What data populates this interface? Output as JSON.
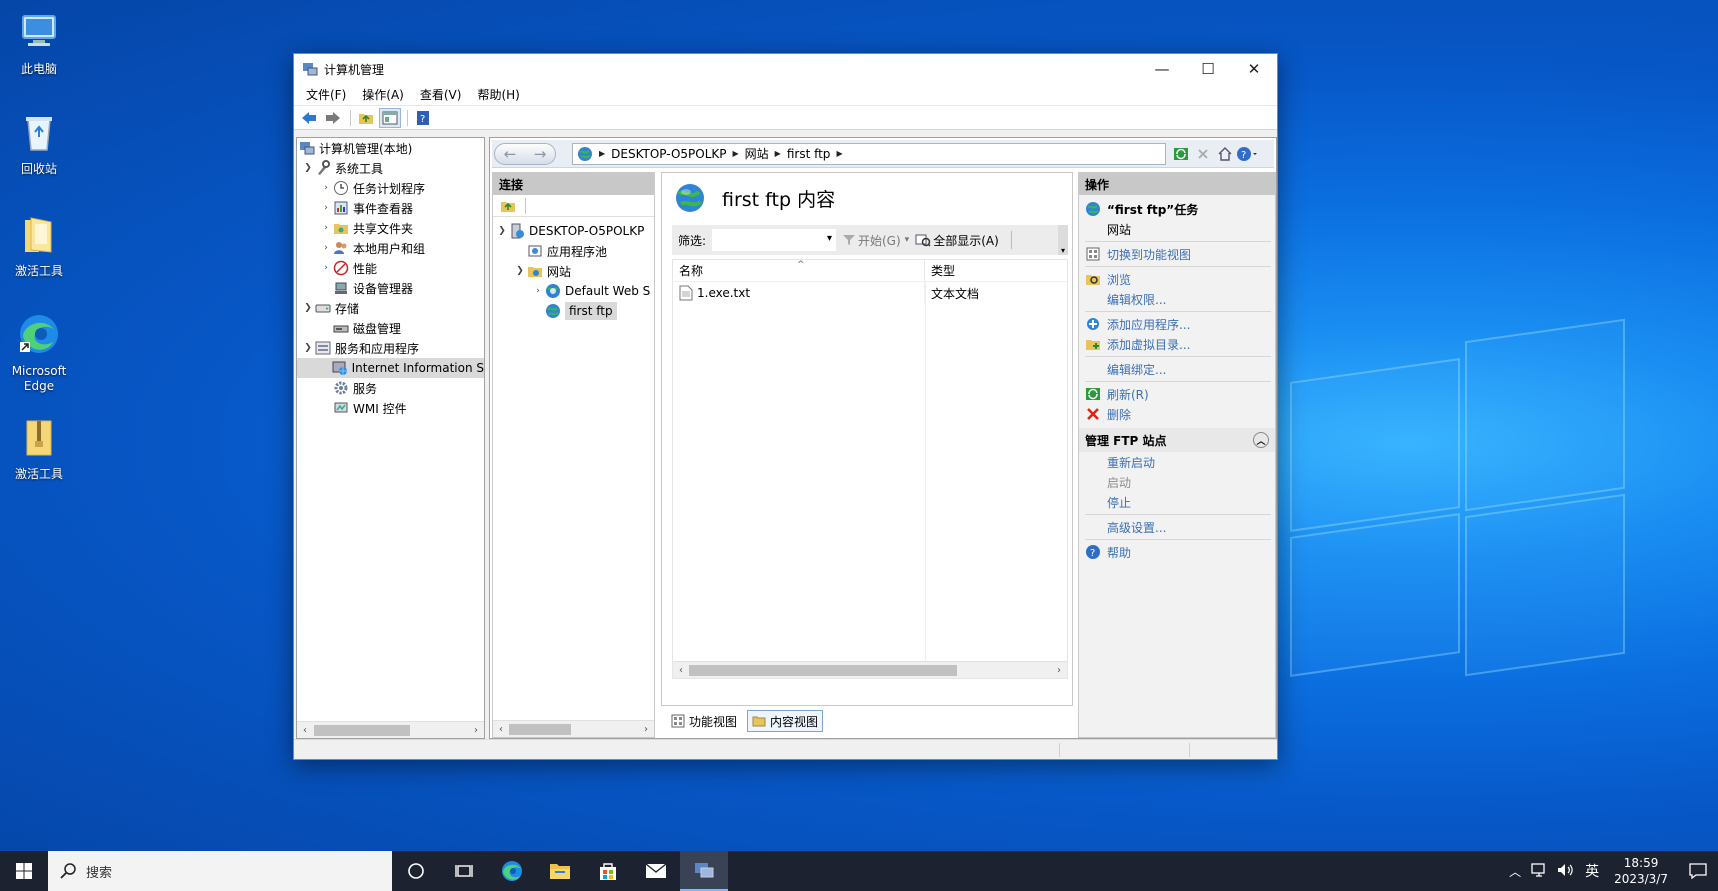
{
  "desktop": {
    "icons": [
      {
        "label": "此电脑",
        "icon": "computer-icon"
      },
      {
        "label": "回收站",
        "icon": "recycle-bin-icon"
      },
      {
        "label": "激活工具",
        "icon": "folder-icon"
      },
      {
        "label": "Microsoft Edge",
        "icon": "edge-icon"
      },
      {
        "label": "激活工具",
        "icon": "zip-folder-icon"
      }
    ]
  },
  "window": {
    "title": "计算机管理",
    "controls": {
      "minimize": "—",
      "maximize": "☐",
      "close": "✕"
    },
    "menu": [
      "文件(F)",
      "操作(A)",
      "查看(V)",
      "帮助(H)"
    ],
    "tree": {
      "root": "计算机管理(本地)",
      "system_tools": "系统工具",
      "task_scheduler": "任务计划程序",
      "event_viewer": "事件查看器",
      "shared_folders": "共享文件夹",
      "local_users": "本地用户和组",
      "performance": "性能",
      "device_manager": "设备管理器",
      "storage": "存储",
      "disk_mgmt": "磁盘管理",
      "services_apps": "服务和应用程序",
      "iis": "Internet Information S",
      "services": "服务",
      "wmi": "WMI 控件"
    }
  },
  "iis": {
    "breadcrumbs": [
      "DESKTOP-O5POLKP",
      "网站",
      "first ftp"
    ],
    "connections": {
      "header": "连接",
      "server": "DESKTOP-O5POLKP",
      "app_pools": "应用程序池",
      "sites": "网站",
      "default_site": "Default Web S",
      "ftp_site": "first ftp"
    },
    "content": {
      "title": "first ftp 内容",
      "filter_label": "筛选:",
      "filter_value": "",
      "start_btn": "开始(G)",
      "show_all_btn": "全部显示(A)",
      "columns": [
        "名称",
        "类型"
      ],
      "rows": [
        {
          "name": "1.exe.txt",
          "type": "文本文档"
        }
      ],
      "feature_view": "功能视图",
      "content_view": "内容视图"
    },
    "actions": {
      "header": "操作",
      "task_title": "“first ftp”任务",
      "site_label": "网站",
      "switch_view": "切换到功能视图",
      "browse": "浏览",
      "edit_perms": "编辑权限...",
      "add_app": "添加应用程序...",
      "add_vdir": "添加虚拟目录...",
      "edit_bindings": "编辑绑定...",
      "refresh": "刷新(R)",
      "delete": "删除",
      "ftp_section": "管理 FTP 站点",
      "restart": "重新启动",
      "start": "启动",
      "stop": "停止",
      "advanced": "高级设置...",
      "help": "帮助"
    }
  },
  "taskbar": {
    "search_placeholder": "搜索",
    "ime": "英",
    "time": "18:59",
    "date": "2023/3/7"
  },
  "colors": {
    "accent": "#0a5fd4",
    "link": "#3b6fb6",
    "taskbar": "#1c2230"
  }
}
